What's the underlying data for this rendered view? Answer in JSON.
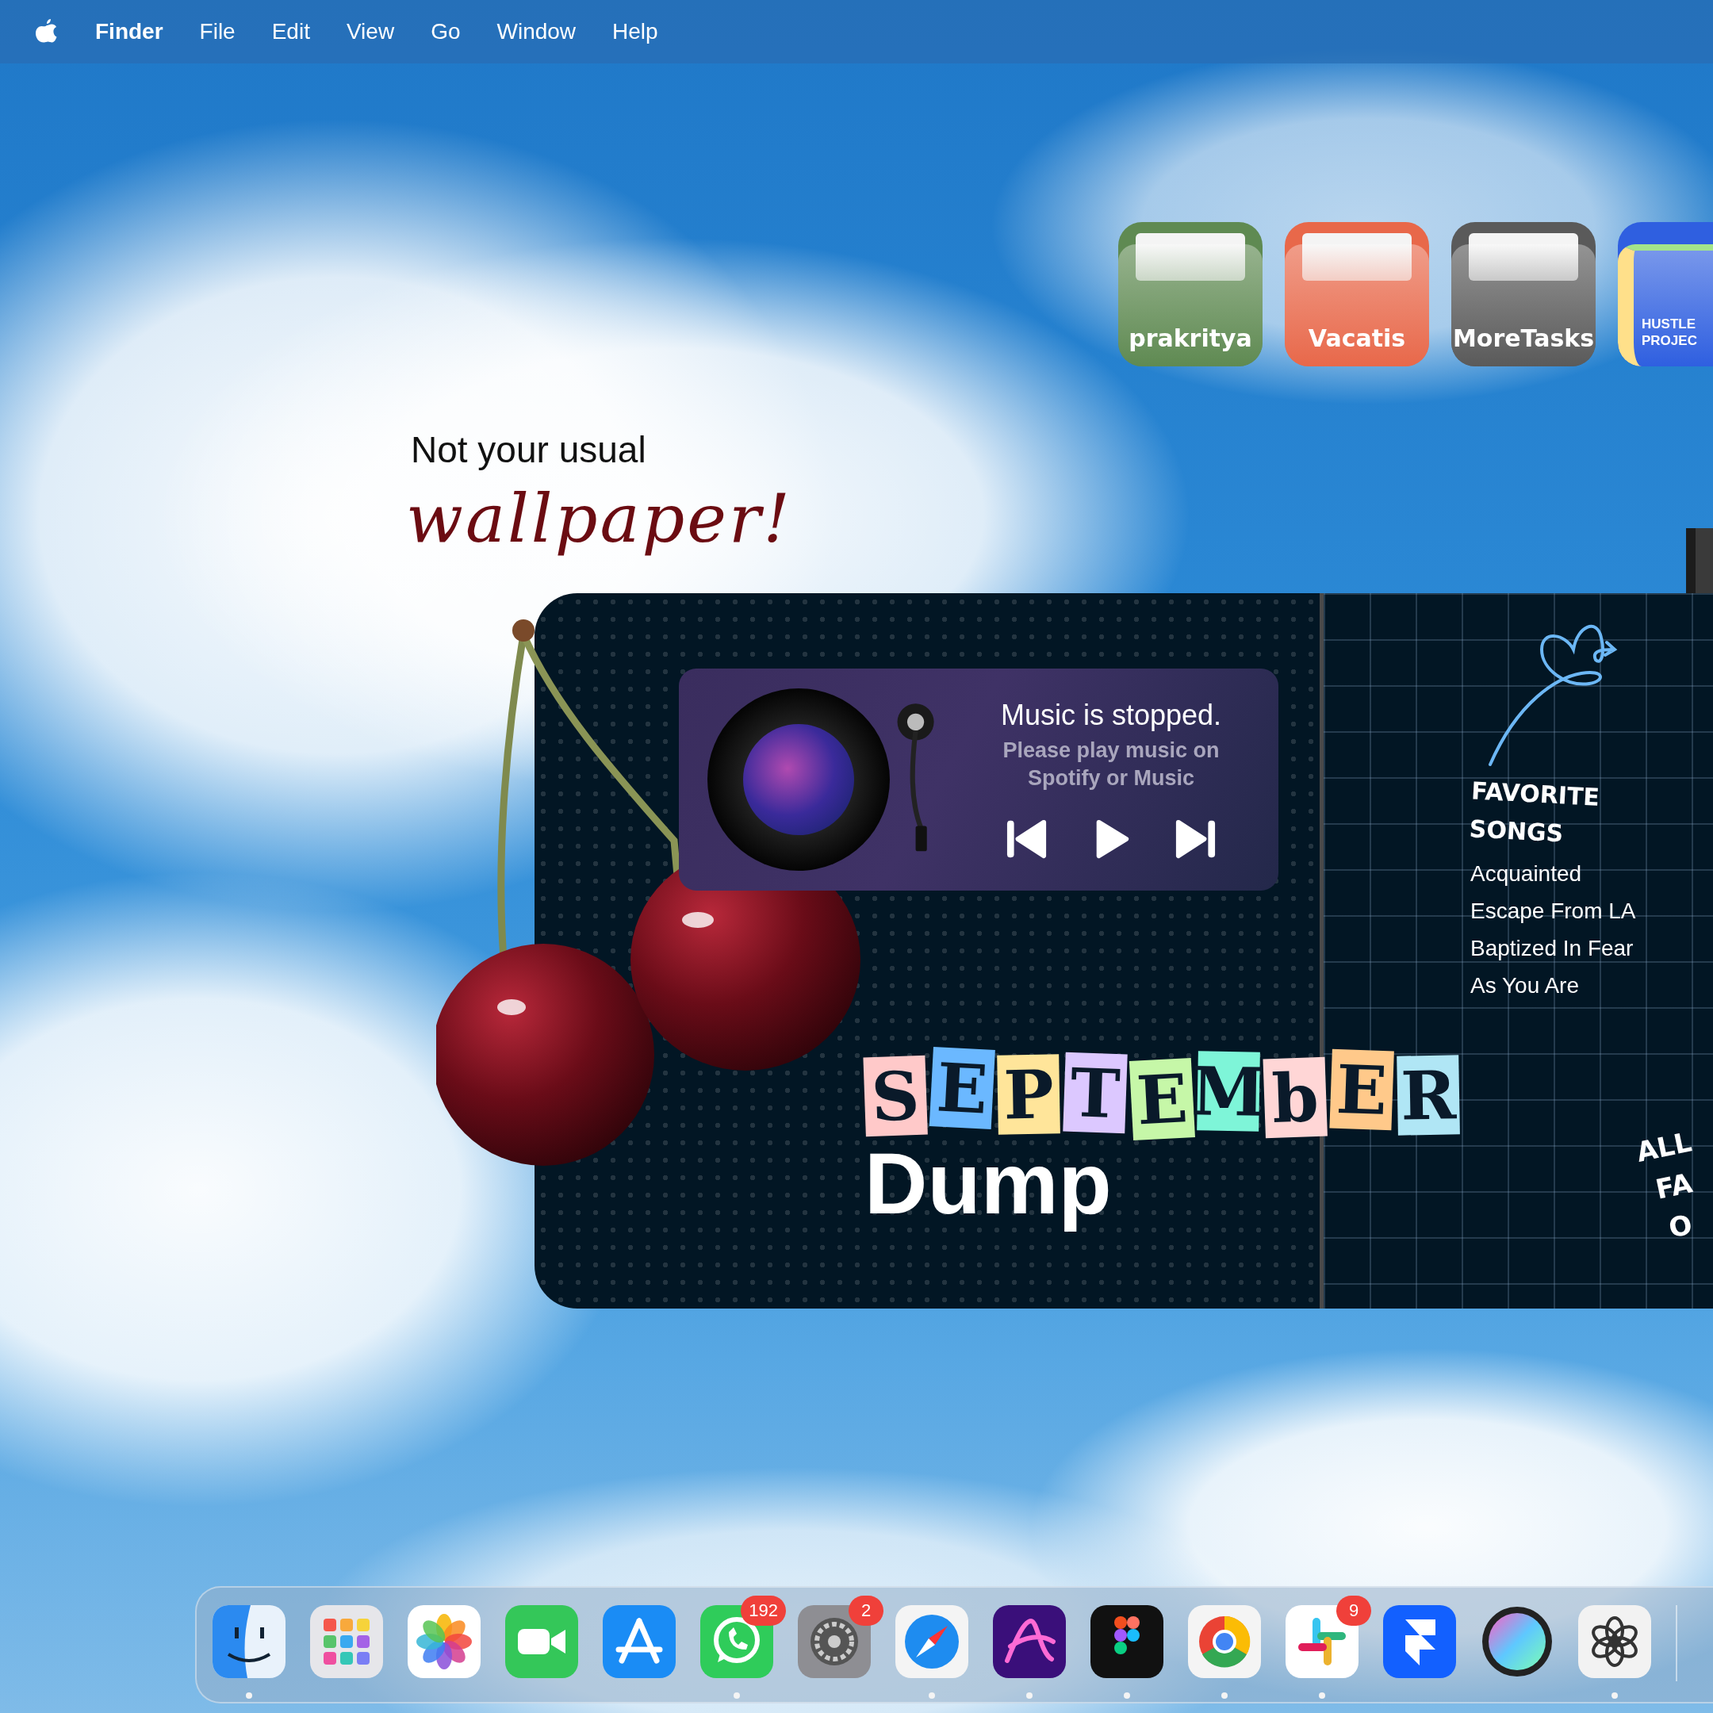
{
  "menu_bar": {
    "items": [
      {
        "label": "Finder",
        "kind": "app"
      },
      {
        "label": "File",
        "kind": "menu"
      },
      {
        "label": "Edit",
        "kind": "menu"
      },
      {
        "label": "View",
        "kind": "menu"
      },
      {
        "label": "Go",
        "kind": "menu"
      },
      {
        "label": "Window",
        "kind": "menu"
      },
      {
        "label": "Help",
        "kind": "menu"
      }
    ]
  },
  "folders": [
    {
      "label": "prakritya",
      "color": "#5f8a52",
      "kind": "plain"
    },
    {
      "label": "Vacatis",
      "color": "#e8684a",
      "kind": "plain"
    },
    {
      "label": "MoreTasks",
      "color": "#5a5a5a",
      "kind": "plain"
    },
    {
      "label": "HUSTLE PROJEC",
      "color": "#2f5fe0",
      "kind": "papers"
    }
  ],
  "tagline": {
    "line_1": "Not your usual",
    "line_2": "wallpaper!"
  },
  "widget": {
    "music": {
      "title": "Music is stopped.",
      "subtitle": "Please play music on Spotify or Music",
      "playing": false
    },
    "heading_letters": [
      {
        "letter": "S",
        "color": "#ffc9c9"
      },
      {
        "letter": "E",
        "color": "#6bb8ff"
      },
      {
        "letter": "P",
        "color": "#ffe59a"
      },
      {
        "letter": "T",
        "color": "#dcc8ff"
      },
      {
        "letter": "E",
        "color": "#c6f7a8"
      },
      {
        "letter": "M",
        "color": "#7ef5d8"
      },
      {
        "letter": "b",
        "color": "#ffd6d6"
      },
      {
        "letter": "E",
        "color": "#ffc98a"
      },
      {
        "letter": "R",
        "color": "#b0e6f5"
      }
    ],
    "subheading": "Dump",
    "songs": {
      "heading": "FAVORITE SONGS",
      "items": [
        "Acquainted",
        "Escape From LA",
        "Baptized In Fear",
        "As You Are"
      ]
    },
    "side_note": [
      "ALL",
      "FA",
      "O"
    ]
  },
  "dock": {
    "items": [
      {
        "kind": "face",
        "running": true
      },
      {
        "kind": "grid",
        "running": false
      },
      {
        "kind": "flower",
        "running": false
      },
      {
        "kind": "camera",
        "running": false
      },
      {
        "kind": "letter-a",
        "running": false
      },
      {
        "kind": "chat",
        "running": true,
        "badge": "192"
      },
      {
        "kind": "gear",
        "running": false,
        "badge": "2"
      },
      {
        "kind": "compass",
        "running": true
      },
      {
        "kind": "scribble",
        "running": true
      },
      {
        "kind": "shapes",
        "running": true
      },
      {
        "kind": "ring",
        "running": true
      },
      {
        "kind": "hash",
        "running": true,
        "badge": "9"
      },
      {
        "kind": "arrow",
        "running": false
      },
      {
        "kind": "sphere",
        "running": false
      },
      {
        "kind": "knot",
        "running": true
      }
    ]
  }
}
